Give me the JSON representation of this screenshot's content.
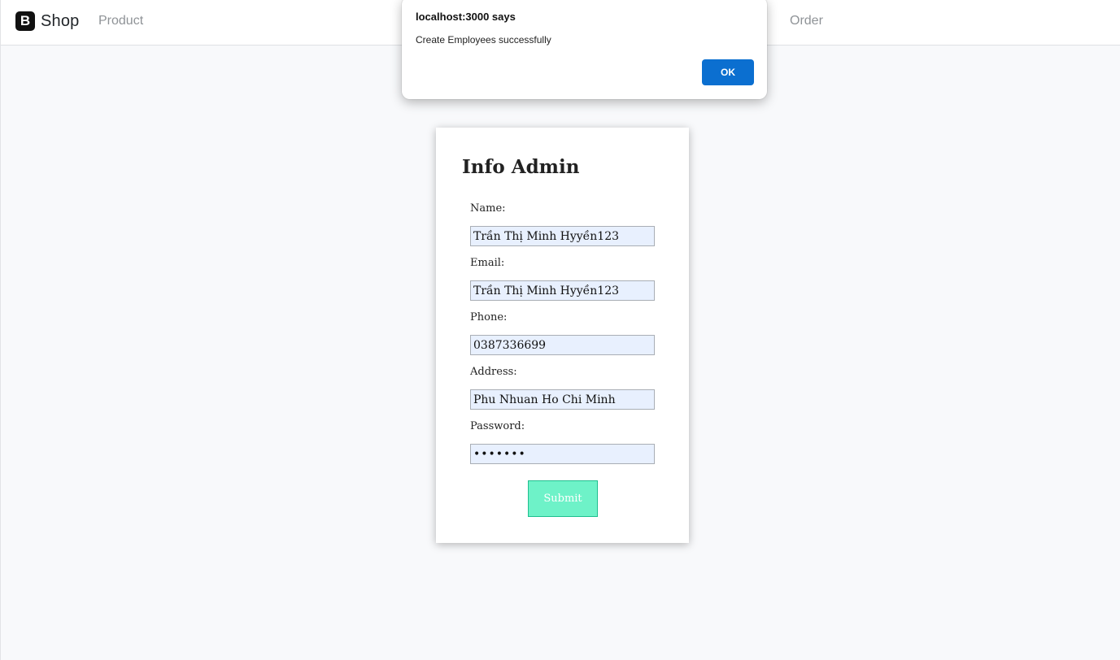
{
  "navbar": {
    "brand_logo_letter": "B",
    "brand_name": "Shop",
    "links": [
      "Product",
      "Order"
    ]
  },
  "alert": {
    "title": "localhost:3000 says",
    "message": "Create Employees successfully",
    "ok_label": "OK"
  },
  "form": {
    "title": "Info Admin",
    "name_label": "Name:",
    "name_value": "Trần Thị Minh Hyyền123",
    "email_label": "Email:",
    "email_value": "Trần Thị Minh Hyyền123",
    "phone_label": "Phone:",
    "phone_value": "0387336699",
    "address_label": "Address:",
    "address_value": "Phu Nhuan Ho Chi Minh",
    "password_label": "Password:",
    "password_value": "•••••••",
    "submit_label": "Submit"
  },
  "colors": {
    "accent_ok": "#0b6fd0",
    "submit_bg": "#6ef2c8",
    "input_bg": "#e8f0fe"
  }
}
